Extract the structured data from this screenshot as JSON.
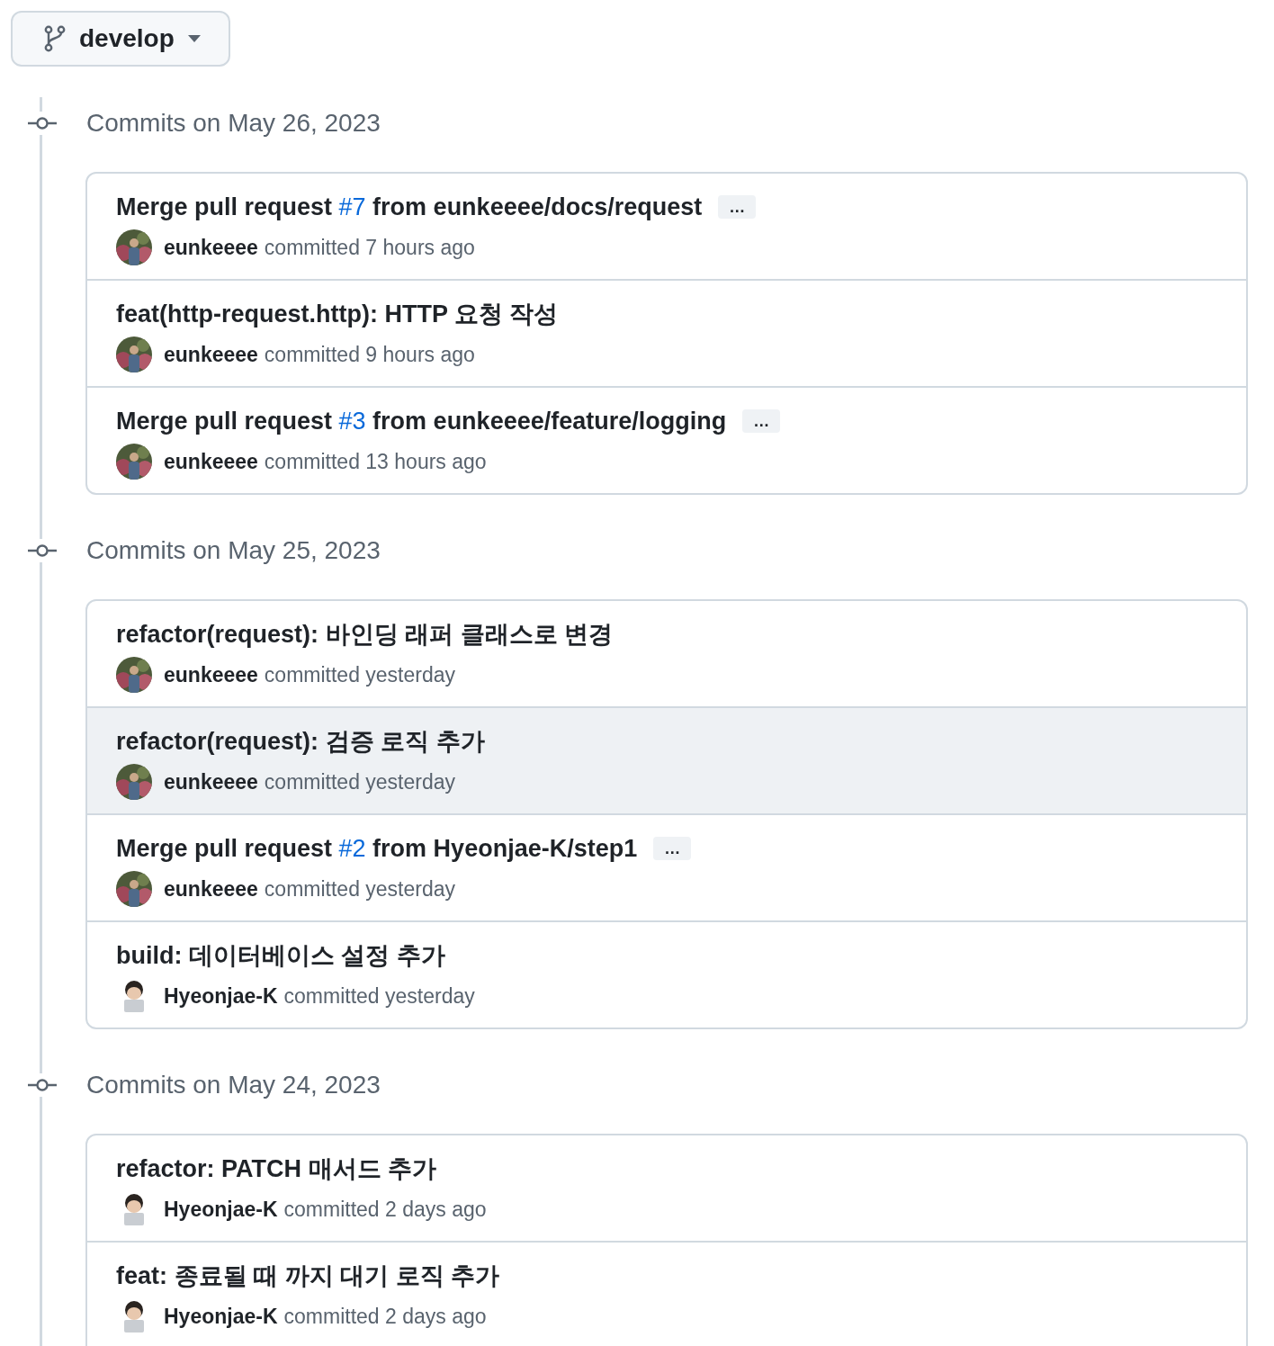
{
  "branch_button": {
    "label": "develop"
  },
  "groups": [
    {
      "date": "Commits on May 26, 2023",
      "commits": [
        {
          "title": "Merge pull request ",
          "pr": "#7",
          "title_rest": " from eunkeeee/docs/request",
          "expand": "…",
          "kind": "photo",
          "author": "eunkeeee",
          "meta": "committed 7 hours ago",
          "hovered": false
        },
        {
          "title": "feat(http-request.http): HTTP 요청 작성",
          "kind": "photo",
          "author": "eunkeeee",
          "meta": "committed 9 hours ago",
          "hovered": false
        },
        {
          "title": "Merge pull request ",
          "pr": "#3",
          "title_rest": " from eunkeeee/feature/logging",
          "expand": "…",
          "kind": "photo",
          "author": "eunkeeee",
          "meta": "committed 13 hours ago",
          "hovered": false
        }
      ]
    },
    {
      "date": "Commits on May 25, 2023",
      "commits": [
        {
          "title": "refactor(request): 바인딩 래퍼 클래스로 변경",
          "kind": "photo",
          "author": "eunkeeee",
          "meta": "committed yesterday",
          "hovered": false
        },
        {
          "title": "refactor(request): 검증 로직 추가",
          "kind": "photo",
          "author": "eunkeeee",
          "meta": "committed yesterday",
          "hovered": true
        },
        {
          "title": "Merge pull request ",
          "pr": "#2",
          "title_rest": " from Hyeonjae-K/step1",
          "expand": "…",
          "kind": "photo",
          "author": "eunkeeee",
          "meta": "committed yesterday",
          "hovered": false
        },
        {
          "title": "build: 데이터베이스 설정 추가",
          "kind": "memoji",
          "author": "Hyeonjae-K",
          "meta": "committed yesterday",
          "hovered": false
        }
      ]
    },
    {
      "date": "Commits on May 24, 2023",
      "commits": [
        {
          "title": "refactor: PATCH 매서드 추가",
          "kind": "memoji",
          "author": "Hyeonjae-K",
          "meta": "committed 2 days ago",
          "hovered": false
        },
        {
          "title": "feat: 종료될 때 까지 대기 로직 추가",
          "kind": "memoji",
          "author": "Hyeonjae-K",
          "meta": "committed 2 days ago",
          "hovered": false
        }
      ]
    }
  ]
}
